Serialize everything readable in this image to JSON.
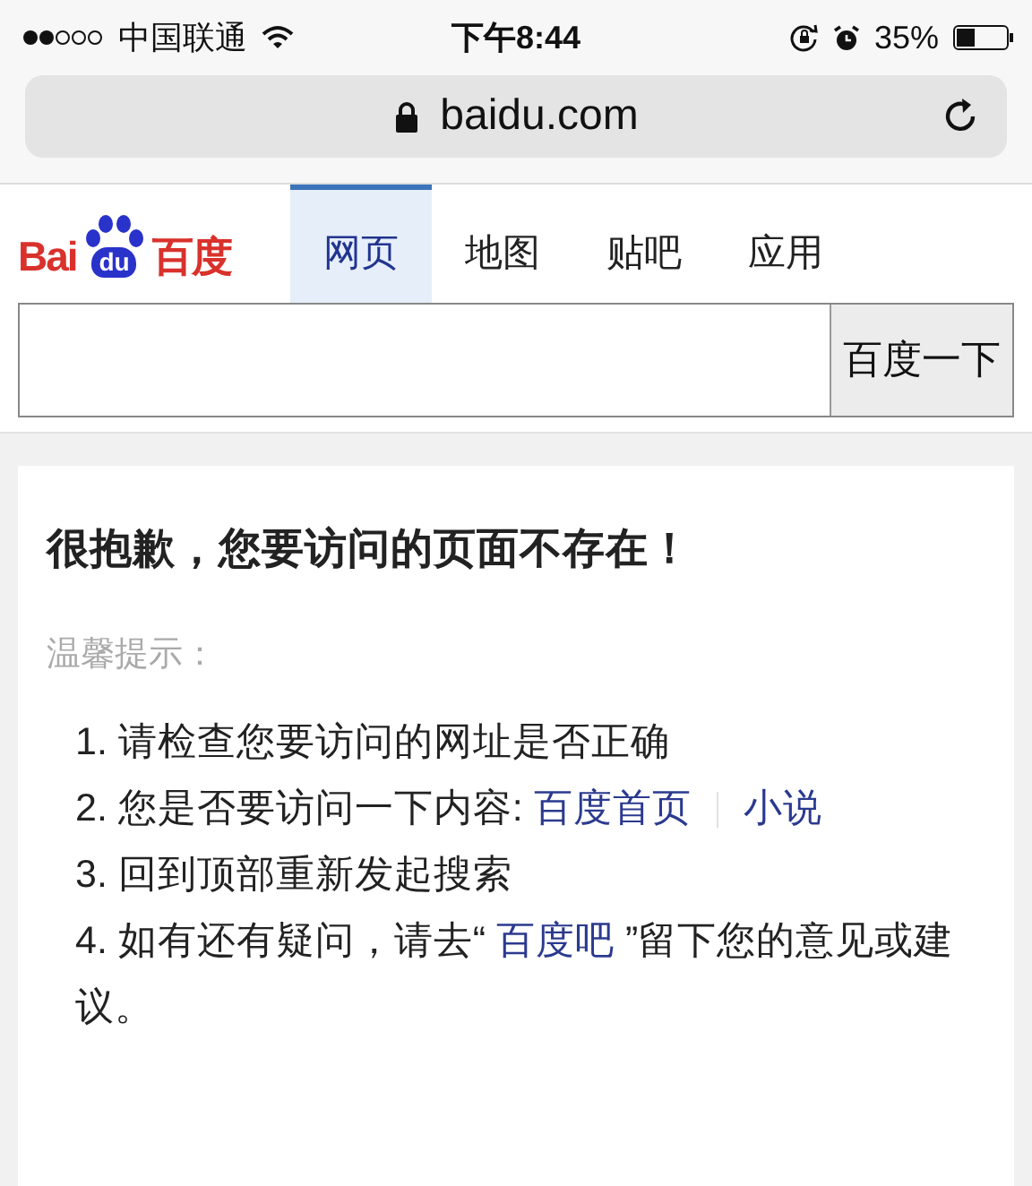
{
  "status_bar": {
    "carrier": "中国联通",
    "time": "下午8:44",
    "battery_percent": "35%"
  },
  "address_bar": {
    "url": "baidu.com"
  },
  "logo": {
    "left": "Bai",
    "paw": "du",
    "right": "百度"
  },
  "tabs": [
    {
      "label": "网页",
      "selected": true
    },
    {
      "label": "地图",
      "selected": false
    },
    {
      "label": "贴吧",
      "selected": false
    },
    {
      "label": "应用",
      "selected": false
    }
  ],
  "search": {
    "button": "百度一下"
  },
  "error": {
    "title": "很抱歉，您要访问的页面不存在！",
    "hint_label": "温馨提示：",
    "tips": [
      {
        "number": "1.",
        "segments": [
          {
            "kind": "text",
            "text": "请检查您要访问的网址是否正确"
          }
        ]
      },
      {
        "number": "2.",
        "segments": [
          {
            "kind": "text",
            "text": "您是否要访问一下内容: "
          },
          {
            "kind": "link",
            "text": "百度首页"
          },
          {
            "kind": "separator"
          },
          {
            "kind": "link",
            "text": "小说"
          }
        ]
      },
      {
        "number": "3.",
        "segments": [
          {
            "kind": "text",
            "text": "回到顶部重新发起搜索"
          }
        ]
      },
      {
        "number": "4.",
        "segments": [
          {
            "kind": "text",
            "text": "如有还有疑问，请去“ "
          },
          {
            "kind": "link",
            "text": "百度吧"
          },
          {
            "kind": "text",
            "text": " ”留下您的意见或建议。"
          }
        ]
      }
    ]
  }
}
